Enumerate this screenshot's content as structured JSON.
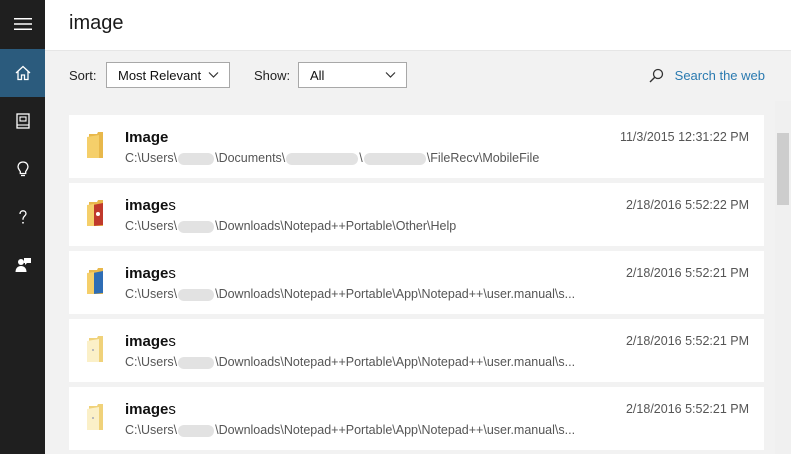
{
  "search": {
    "query": "image"
  },
  "filters": {
    "sort_label": "Sort:",
    "sort_value": "Most Relevant",
    "show_label": "Show:",
    "show_value": "All",
    "web_search_label": "Search the web"
  },
  "rail": {
    "items": [
      {
        "name": "menu-icon"
      },
      {
        "name": "home-icon"
      },
      {
        "name": "notebook-icon"
      },
      {
        "name": "lightbulb-icon"
      },
      {
        "name": "help-icon"
      },
      {
        "name": "feedback-icon"
      }
    ]
  },
  "results": [
    {
      "title_bold": "Image",
      "title_rest": "",
      "path_parts": [
        "C:\\Users\\",
        "\\Documents\\",
        "\\",
        "\\FileRecv\\MobileFile"
      ],
      "date": "11/3/2015 12:31:22 PM",
      "icon": "folder-icon"
    },
    {
      "title_bold": "image",
      "title_rest": "s",
      "path_parts": [
        "C:\\Users\\",
        "\\Downloads\\Notepad++Portable\\Other\\Help"
      ],
      "date": "2/18/2016 5:52:22 PM",
      "icon": "folder-red-icon"
    },
    {
      "title_bold": "image",
      "title_rest": "s",
      "path_parts": [
        "C:\\Users\\",
        "\\Downloads\\Notepad++Portable\\App\\Notepad++\\user.manual\\s..."
      ],
      "date": "2/18/2016 5:52:21 PM",
      "icon": "folder-blue-icon"
    },
    {
      "title_bold": "image",
      "title_rest": "s",
      "path_parts": [
        "C:\\Users\\",
        "\\Downloads\\Notepad++Portable\\App\\Notepad++\\user.manual\\s..."
      ],
      "date": "2/18/2016 5:52:21 PM",
      "icon": "folder-light-icon"
    },
    {
      "title_bold": "image",
      "title_rest": "s",
      "path_parts": [
        "C:\\Users\\",
        "\\Downloads\\Notepad++Portable\\App\\Notepad++\\user.manual\\s..."
      ],
      "date": "2/18/2016 5:52:21 PM",
      "icon": "folder-light-icon"
    }
  ]
}
